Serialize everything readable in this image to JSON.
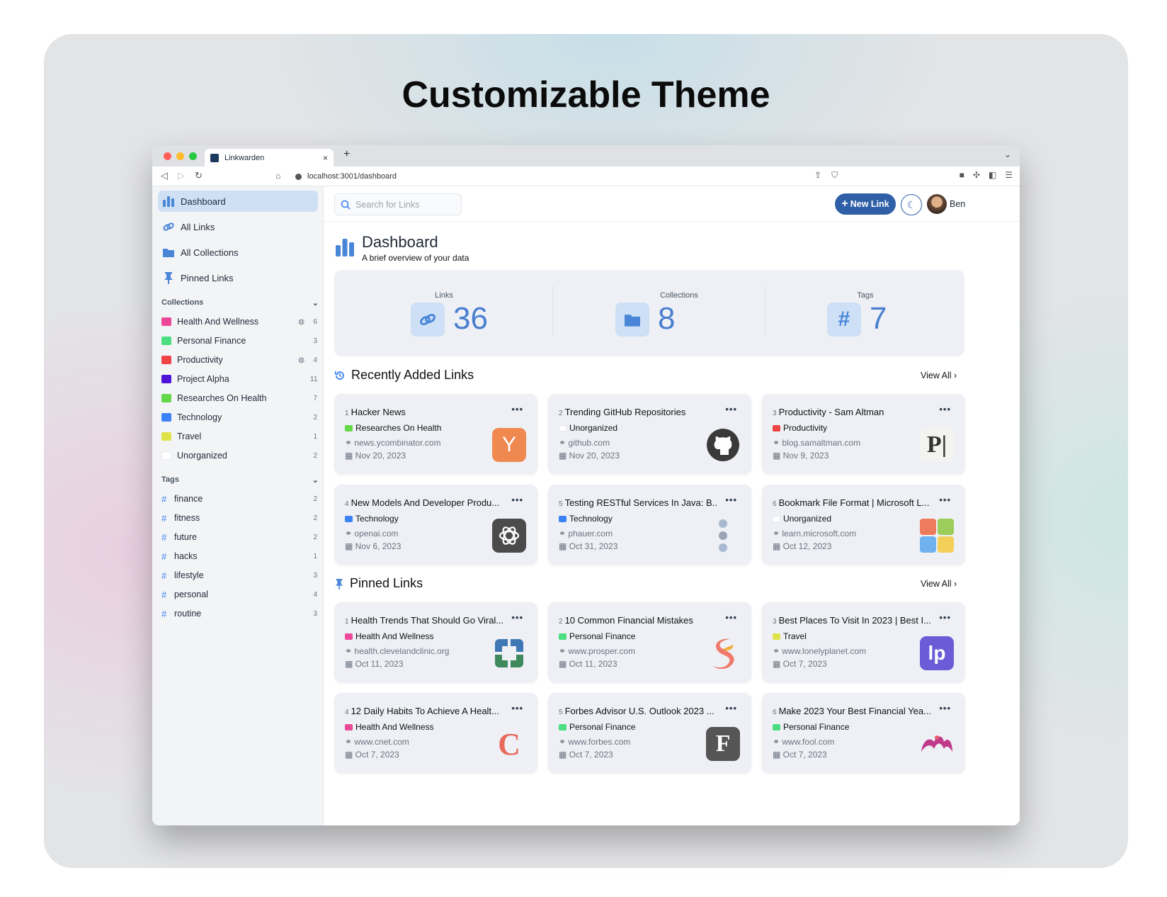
{
  "headline": "Customizable Theme",
  "browser": {
    "tab_title": "Linkwarden",
    "tab_close": "×",
    "new_tab": "+",
    "url": "localhost:3001/dashboard"
  },
  "sidebar": {
    "nav": [
      {
        "label": "Dashboard"
      },
      {
        "label": "All Links"
      },
      {
        "label": "All Collections"
      },
      {
        "label": "Pinned Links"
      }
    ],
    "collections_header": "Collections",
    "collections": [
      {
        "name": "Health And Wellness",
        "count": "6",
        "public": true,
        "color": "#ec4899"
      },
      {
        "name": "Personal Finance",
        "count": "3",
        "public": false,
        "color": "#4ade80"
      },
      {
        "name": "Productivity",
        "count": "4",
        "public": true,
        "color": "#ef4444"
      },
      {
        "name": "Project Alpha",
        "count": "11",
        "public": false,
        "color": "#4f14d8"
      },
      {
        "name": "Researches On Health",
        "count": "7",
        "public": false,
        "color": "#65d84a"
      },
      {
        "name": "Technology",
        "count": "2",
        "public": false,
        "color": "#3b82f6"
      },
      {
        "name": "Travel",
        "count": "1",
        "public": false,
        "color": "#dfe34a"
      },
      {
        "name": "Unorganized",
        "count": "2",
        "public": false,
        "color": "#ffffff"
      }
    ],
    "tags_header": "Tags",
    "tags": [
      {
        "name": "finance",
        "count": "2"
      },
      {
        "name": "fitness",
        "count": "2"
      },
      {
        "name": "future",
        "count": "2"
      },
      {
        "name": "hacks",
        "count": "1"
      },
      {
        "name": "lifestyle",
        "count": "3"
      },
      {
        "name": "personal",
        "count": "4"
      },
      {
        "name": "routine",
        "count": "3"
      }
    ]
  },
  "topbar": {
    "search_placeholder": "Search for Links",
    "new_link": "New Link",
    "user": "Ben"
  },
  "page": {
    "title": "Dashboard",
    "subtitle": "A brief overview of your data"
  },
  "stats": [
    {
      "label": "Links",
      "value": "36"
    },
    {
      "label": "Collections",
      "value": "8"
    },
    {
      "label": "Tags",
      "value": "7"
    }
  ],
  "recent": {
    "title": "Recently Added Links",
    "view_all": "View All",
    "items": [
      {
        "n": "1",
        "title": "Hacker News",
        "collection": "Researches On Health",
        "color": "#65d84a",
        "domain": "news.ycombinator.com",
        "date": "Nov 20, 2023",
        "logo": "Y",
        "logo_bg": "#f0894f"
      },
      {
        "n": "2",
        "title": "Trending GitHub Repositories",
        "collection": "Unorganized",
        "color": "#ffffff",
        "domain": "github.com",
        "date": "Nov 20, 2023",
        "logo": "github",
        "logo_bg": "transparent"
      },
      {
        "n": "3",
        "title": "Productivity - Sam Altman",
        "collection": "Productivity",
        "color": "#ef4444",
        "domain": "blog.samaltman.com",
        "date": "Nov 9, 2023",
        "logo": "P|",
        "logo_bg": "#f3f3f0"
      },
      {
        "n": "4",
        "title": "New Models And Developer Produ...",
        "collection": "Technology",
        "color": "#3b82f6",
        "domain": "openai.com",
        "date": "Nov 6, 2023",
        "logo": "openai",
        "logo_bg": "#4b4b4b"
      },
      {
        "n": "5",
        "title": "Testing RESTful Services In Java: B...",
        "collection": "Technology",
        "color": "#3b82f6",
        "domain": "phauer.com",
        "date": "Oct 31, 2023",
        "logo": "dots",
        "logo_bg": "transparent"
      },
      {
        "n": "6",
        "title": "Bookmark File Format | Microsoft L...",
        "collection": "Unorganized",
        "color": "#ffffff",
        "domain": "learn.microsoft.com",
        "date": "Oct 12, 2023",
        "logo": "ms",
        "logo_bg": "transparent"
      }
    ]
  },
  "pinned": {
    "title": "Pinned Links",
    "view_all": "View All",
    "items": [
      {
        "n": "1",
        "title": "Health Trends That Should Go Viral...",
        "collection": "Health And Wellness",
        "color": "#ec4899",
        "domain": "health.clevelandclinic.org",
        "date": "Oct 11, 2023",
        "logo": "cc",
        "logo_bg": "transparent"
      },
      {
        "n": "2",
        "title": "10 Common Financial Mistakes",
        "collection": "Personal Finance",
        "color": "#4ade80",
        "domain": "www.prosper.com",
        "date": "Oct 11, 2023",
        "logo": "prosper",
        "logo_bg": "transparent"
      },
      {
        "n": "3",
        "title": "Best Places To Visit In 2023 | Best I...",
        "collection": "Travel",
        "color": "#dfe34a",
        "domain": "www.lonelyplanet.com",
        "date": "Oct 7, 2023",
        "logo": "lp",
        "logo_bg": "#6b5bd6"
      },
      {
        "n": "4",
        "title": "12 Daily Habits To Achieve A Healt...",
        "collection": "Health And Wellness",
        "color": "#ec4899",
        "domain": "www.cnet.com",
        "date": "Oct 7, 2023",
        "logo": "C",
        "logo_bg": "transparent"
      },
      {
        "n": "5",
        "title": "Forbes Advisor U.S. Outlook 2023 ...",
        "collection": "Personal Finance",
        "color": "#4ade80",
        "domain": "www.forbes.com",
        "date": "Oct 7, 2023",
        "logo": "F",
        "logo_bg": "#555"
      },
      {
        "n": "6",
        "title": "Make 2023 Your Best Financial Yea...",
        "collection": "Personal Finance",
        "color": "#4ade80",
        "domain": "www.fool.com",
        "date": "Oct 7, 2023",
        "logo": "fool",
        "logo_bg": "transparent"
      }
    ]
  },
  "colors": {
    "accent": "#2f5fa7",
    "stat_number": "#4a7fd0",
    "active_nav": "#cfe0f5"
  }
}
